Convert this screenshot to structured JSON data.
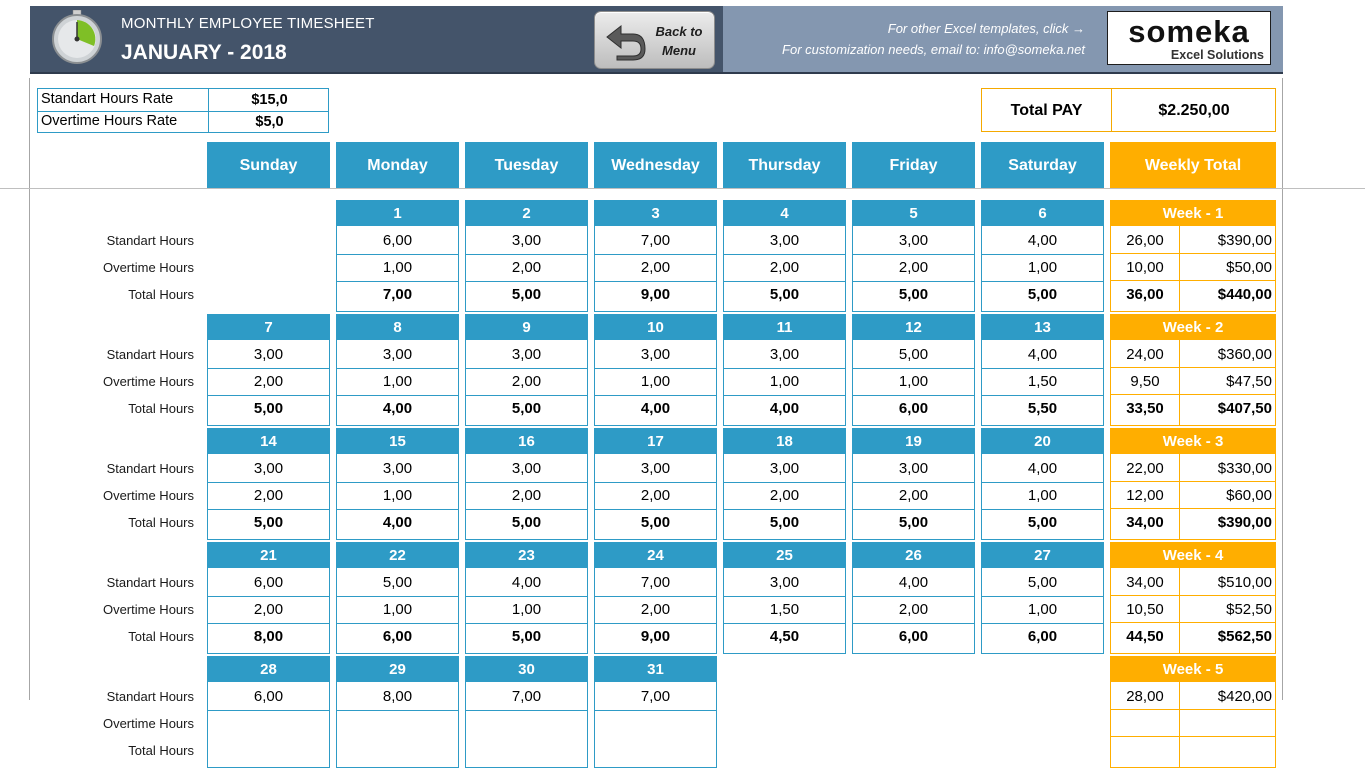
{
  "header": {
    "subtitle": "MONTHLY EMPLOYEE TIMESHEET",
    "title": "JANUARY - 2018",
    "back_button_line1": "Back to",
    "back_button_line2": "Menu",
    "link_text": "For other Excel templates, click →",
    "email_text": "For customization needs, email to: info@someka.net",
    "logo_word": "someka",
    "logo_sub": "Excel Solutions",
    "header_color": "#44546a",
    "accent_blue": "#2e9bc6",
    "accent_orange": "#ffae00"
  },
  "rates": {
    "standard_label": "Standart Hours Rate",
    "standard_value": "$15,0",
    "overtime_label": "Overtime Hours Rate",
    "overtime_value": "$5,0"
  },
  "total_pay": {
    "label": "Total PAY",
    "value": "$2.250,00"
  },
  "days": [
    "Sunday",
    "Monday",
    "Tuesday",
    "Wednesday",
    "Thursday",
    "Friday",
    "Saturday"
  ],
  "weekly_total_label": "Weekly Total",
  "row_labels": {
    "standard": "Standart Hours",
    "overtime": "Overtime Hours",
    "total": "Total Hours"
  },
  "weeks": [
    {
      "label": "Week - 1",
      "days": [
        null,
        {
          "day": "1",
          "std": "6,00",
          "ot": "1,00",
          "total": "7,00"
        },
        {
          "day": "2",
          "std": "3,00",
          "ot": "2,00",
          "total": "5,00"
        },
        {
          "day": "3",
          "std": "7,00",
          "ot": "2,00",
          "total": "9,00"
        },
        {
          "day": "4",
          "std": "3,00",
          "ot": "2,00",
          "total": "5,00"
        },
        {
          "day": "5",
          "std": "3,00",
          "ot": "2,00",
          "total": "5,00"
        },
        {
          "day": "6",
          "std": "4,00",
          "ot": "1,00",
          "total": "5,00"
        }
      ],
      "summary": {
        "std_hours": "26,00",
        "std_pay": "$390,00",
        "ot_hours": "10,00",
        "ot_pay": "$50,00",
        "total_hours": "36,00",
        "total_pay": "$440,00"
      }
    },
    {
      "label": "Week - 2",
      "days": [
        {
          "day": "7",
          "std": "3,00",
          "ot": "2,00",
          "total": "5,00"
        },
        {
          "day": "8",
          "std": "3,00",
          "ot": "1,00",
          "total": "4,00"
        },
        {
          "day": "9",
          "std": "3,00",
          "ot": "2,00",
          "total": "5,00"
        },
        {
          "day": "10",
          "std": "3,00",
          "ot": "1,00",
          "total": "4,00"
        },
        {
          "day": "11",
          "std": "3,00",
          "ot": "1,00",
          "total": "4,00"
        },
        {
          "day": "12",
          "std": "5,00",
          "ot": "1,00",
          "total": "6,00"
        },
        {
          "day": "13",
          "std": "4,00",
          "ot": "1,50",
          "total": "5,50"
        }
      ],
      "summary": {
        "std_hours": "24,00",
        "std_pay": "$360,00",
        "ot_hours": "9,50",
        "ot_pay": "$47,50",
        "total_hours": "33,50",
        "total_pay": "$407,50"
      }
    },
    {
      "label": "Week - 3",
      "days": [
        {
          "day": "14",
          "std": "3,00",
          "ot": "2,00",
          "total": "5,00"
        },
        {
          "day": "15",
          "std": "3,00",
          "ot": "1,00",
          "total": "4,00"
        },
        {
          "day": "16",
          "std": "3,00",
          "ot": "2,00",
          "total": "5,00"
        },
        {
          "day": "17",
          "std": "3,00",
          "ot": "2,00",
          "total": "5,00"
        },
        {
          "day": "18",
          "std": "3,00",
          "ot": "2,00",
          "total": "5,00"
        },
        {
          "day": "19",
          "std": "3,00",
          "ot": "2,00",
          "total": "5,00"
        },
        {
          "day": "20",
          "std": "4,00",
          "ot": "1,00",
          "total": "5,00"
        }
      ],
      "summary": {
        "std_hours": "22,00",
        "std_pay": "$330,00",
        "ot_hours": "12,00",
        "ot_pay": "$60,00",
        "total_hours": "34,00",
        "total_pay": "$390,00"
      }
    },
    {
      "label": "Week - 4",
      "days": [
        {
          "day": "21",
          "std": "6,00",
          "ot": "2,00",
          "total": "8,00"
        },
        {
          "day": "22",
          "std": "5,00",
          "ot": "1,00",
          "total": "6,00"
        },
        {
          "day": "23",
          "std": "4,00",
          "ot": "1,00",
          "total": "5,00"
        },
        {
          "day": "24",
          "std": "7,00",
          "ot": "2,00",
          "total": "9,00"
        },
        {
          "day": "25",
          "std": "3,00",
          "ot": "1,50",
          "total": "4,50"
        },
        {
          "day": "26",
          "std": "4,00",
          "ot": "2,00",
          "total": "6,00"
        },
        {
          "day": "27",
          "std": "5,00",
          "ot": "1,00",
          "total": "6,00"
        }
      ],
      "summary": {
        "std_hours": "34,00",
        "std_pay": "$510,00",
        "ot_hours": "10,50",
        "ot_pay": "$52,50",
        "total_hours": "44,50",
        "total_pay": "$562,50"
      }
    },
    {
      "label": "Week - 5",
      "days": [
        {
          "day": "28",
          "std": "6,00"
        },
        {
          "day": "29",
          "std": "8,00"
        },
        {
          "day": "30",
          "std": "7,00"
        },
        {
          "day": "31",
          "std": "7,00"
        },
        null,
        null,
        null
      ],
      "summary": {
        "std_hours": "28,00",
        "std_pay": "$420,00"
      }
    }
  ]
}
